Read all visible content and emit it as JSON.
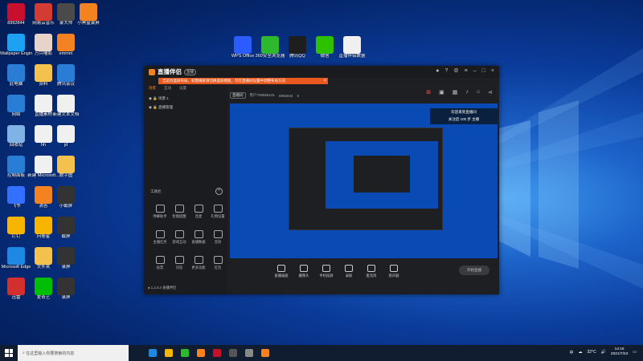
{
  "desktop": {
    "icons": [
      {
        "label": "8992844",
        "color": "#c8102e"
      },
      {
        "label": "网易云音乐",
        "color": "#d43c33"
      },
      {
        "label": "录大师",
        "color": "#4a4a4a"
      },
      {
        "label": "小黑盒录屏",
        "color": "#f58220"
      },
      {
        "label": "Wallpaper Engine 壁纸",
        "color": "#1da1f2"
      },
      {
        "label": "万兴喵影",
        "color": "#e8d3c9"
      },
      {
        "label": "emmm",
        "color": "#f58220"
      },
      {
        "label": "此电脑",
        "color": "#2a7dd4"
      },
      {
        "label": "资料",
        "color": "#f2c14e"
      },
      {
        "label": "腾讯会议",
        "color": "#2a7dd4"
      },
      {
        "label": "网络",
        "color": "#2a7dd4"
      },
      {
        "label": "直播素材",
        "color": "#f0f0f0"
      },
      {
        "label": "新建文本文档",
        "color": "#f0f0f0"
      },
      {
        "label": "回收站",
        "color": "#7fb2e5"
      },
      {
        "label": "hh",
        "color": "#f0f0f0"
      },
      {
        "label": "jd",
        "color": "#f0f0f0"
      },
      {
        "label": "控制面板",
        "color": "#2a7dd4"
      },
      {
        "label": "新建 Microsoft...",
        "color": "#f0f0f0"
      },
      {
        "label": "数字图",
        "color": "#f2c14e"
      },
      {
        "label": "飞书",
        "color": "#3370ff"
      },
      {
        "label": "滴答",
        "color": "#f58220"
      },
      {
        "label": "小截屏",
        "color": "#333333"
      },
      {
        "label": "钉钉",
        "color": "#f7b500"
      },
      {
        "label": "问卷星",
        "color": "#f7b500"
      },
      {
        "label": "截屏",
        "color": "#333333"
      },
      {
        "label": "Microsoft Edge",
        "color": "#1e88e5"
      },
      {
        "label": "文件夹",
        "color": "#f2c14e"
      },
      {
        "label": "录屏",
        "color": "#333333"
      },
      {
        "label": "迅雷",
        "color": "#d32f2f"
      },
      {
        "label": "爱奇艺",
        "color": "#00be06"
      },
      {
        "label": "录屏",
        "color": "#333333"
      },
      {
        "label": "WPS Office",
        "color": "#2b5cff"
      },
      {
        "label": "360安全浏览器",
        "color": "#2eb82e"
      },
      {
        "label": "腾讯QQ",
        "color": "#1e1e1e"
      },
      {
        "label": "微信",
        "color": "#2dc100"
      },
      {
        "label": "直播伴侣数据",
        "color": "#f0f0f0"
      }
    ]
  },
  "app": {
    "title": "直播伴侣",
    "badge": "直播",
    "notice": "当前为竖屏布局，如需横屏请切换竖屏模板，可在直播间设置中调整布局方向",
    "tabs": [
      "场景",
      "互动",
      "设置"
    ],
    "scenes": [
      "场景 1",
      "直播管理"
    ],
    "tools_title": "工具栏",
    "tools": [
      "弹幕助手",
      "智能提醒",
      "连麦",
      "礼物设置",
      "主播任务",
      "游戏互动",
      "直播数据",
      "音效",
      "投票",
      "问答",
      "更多功能",
      "红包"
    ],
    "left_footer": "1.2.3.4 直播伴侣",
    "live_bar": {
      "stream_btn": "直播间",
      "user": "用户706566131",
      "id": "8992844",
      "count": "0"
    },
    "right_banner": [
      "欢迎来到直播间",
      "关注后 100 步 主播"
    ],
    "controls": [
      "直播画面",
      "摄像头",
      "手机投屏",
      "录屏",
      "麦克风",
      "扬声器"
    ],
    "start_button": "开始直播"
  },
  "taskbar": {
    "search_placeholder": "在这里输入你要搜索的内容",
    "temperature": "32°C",
    "ime": "中",
    "time": "14:16",
    "date": "2021/7/23",
    "pinned_colors": [
      "#1e88e5",
      "#f7b500",
      "#2eb82e",
      "#f58220",
      "#c8102e",
      "#555555",
      "#888888",
      "#f58220"
    ]
  }
}
